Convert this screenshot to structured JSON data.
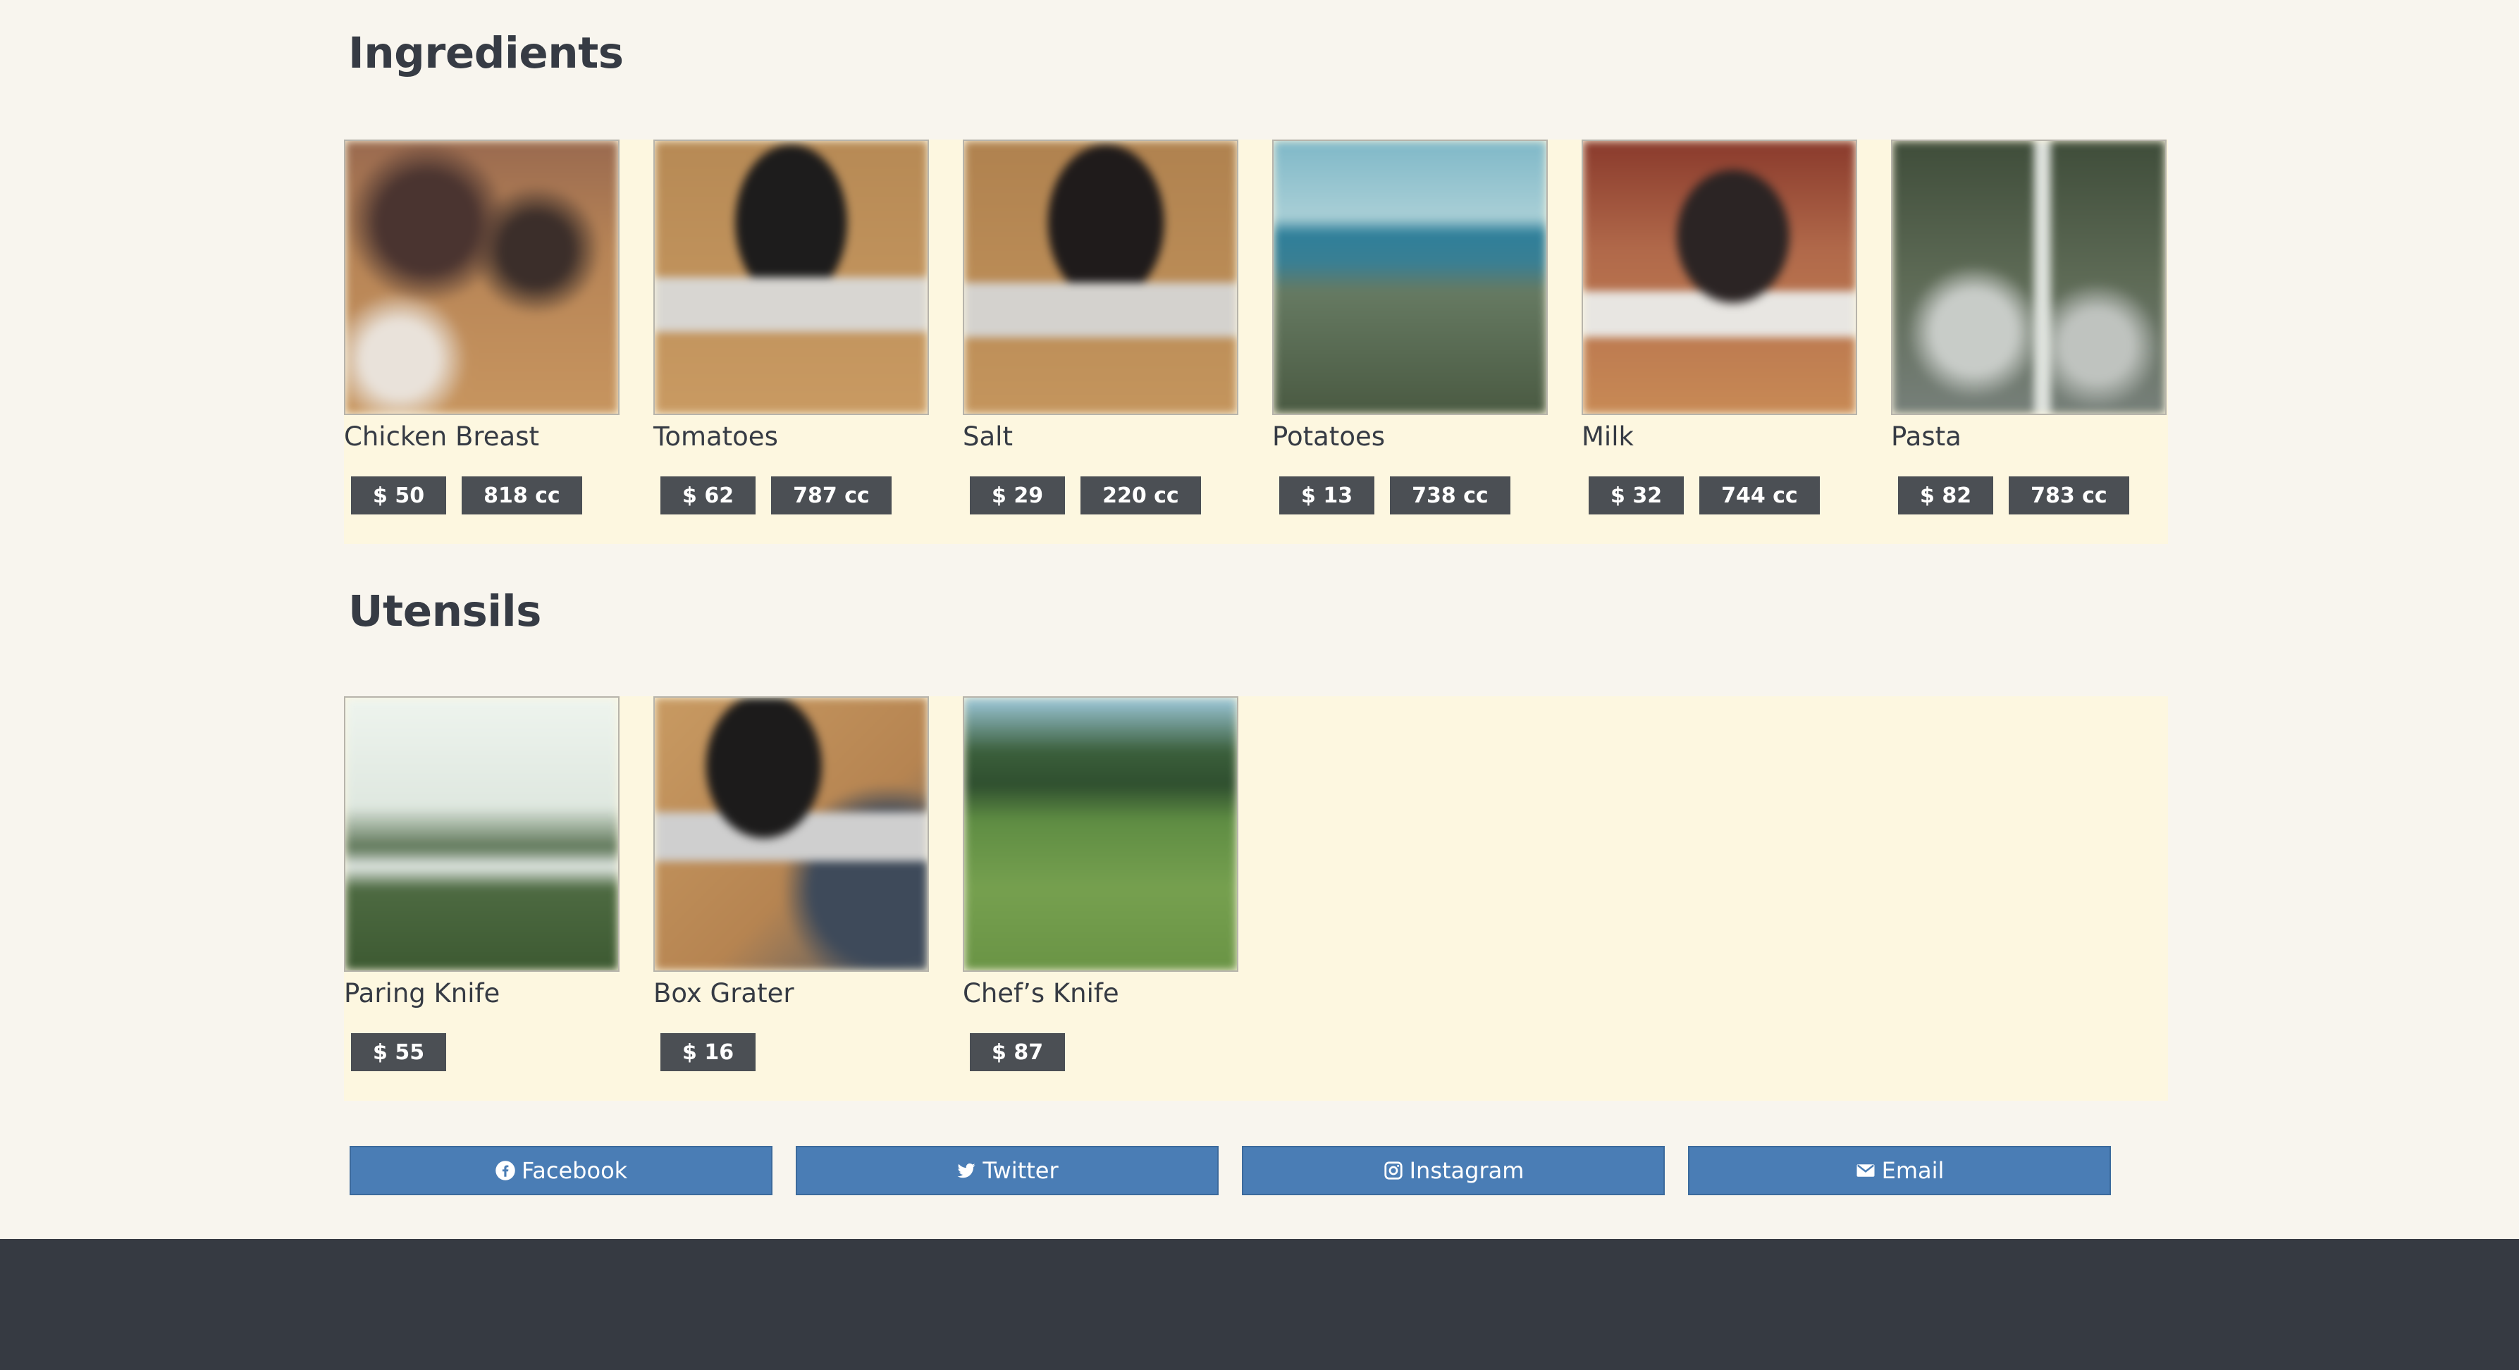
{
  "ingredients": {
    "title": "Ingredients",
    "items": [
      {
        "name": "Chicken Breast",
        "price": "$ 50",
        "volume": "818 cc",
        "image": "blurred-photo-desk-with-items"
      },
      {
        "name": "Tomatoes",
        "price": "$ 62",
        "volume": "787 cc",
        "image": "blurred-photo-laptop-on-wooden-table"
      },
      {
        "name": "Salt",
        "price": "$ 29",
        "volume": "220 cc",
        "image": "blurred-photo-laptop-on-wooden-table"
      },
      {
        "name": "Potatoes",
        "price": "$ 13",
        "volume": "738 cc",
        "image": "blurred-photo-sea-and-grass"
      },
      {
        "name": "Milk",
        "price": "$ 32",
        "volume": "744 cc",
        "image": "blurred-photo-laptop-on-desk"
      },
      {
        "name": "Pasta",
        "price": "$ 82",
        "volume": "783 cc",
        "image": "blurred-photo-waterfall-rocks"
      }
    ]
  },
  "utensils": {
    "title": "Utensils",
    "items": [
      {
        "name": "Paring Knife",
        "price": "$ 55",
        "image": "blurred-photo-misty-lake"
      },
      {
        "name": "Box Grater",
        "price": "$ 16",
        "image": "blurred-photo-person-with-laptop"
      },
      {
        "name": "Chef’s Knife",
        "price": "$ 87",
        "image": "blurred-photo-grass-field-trees"
      }
    ]
  },
  "share": {
    "facebook": "Facebook",
    "twitter": "Twitter",
    "instagram": "Instagram",
    "email": "Email"
  },
  "colors": {
    "background": "#f8f5ee",
    "panel": "#fdf7e0",
    "tag": "#4b4f54",
    "share_button": "#4a7db5",
    "footer": "#363a42"
  }
}
